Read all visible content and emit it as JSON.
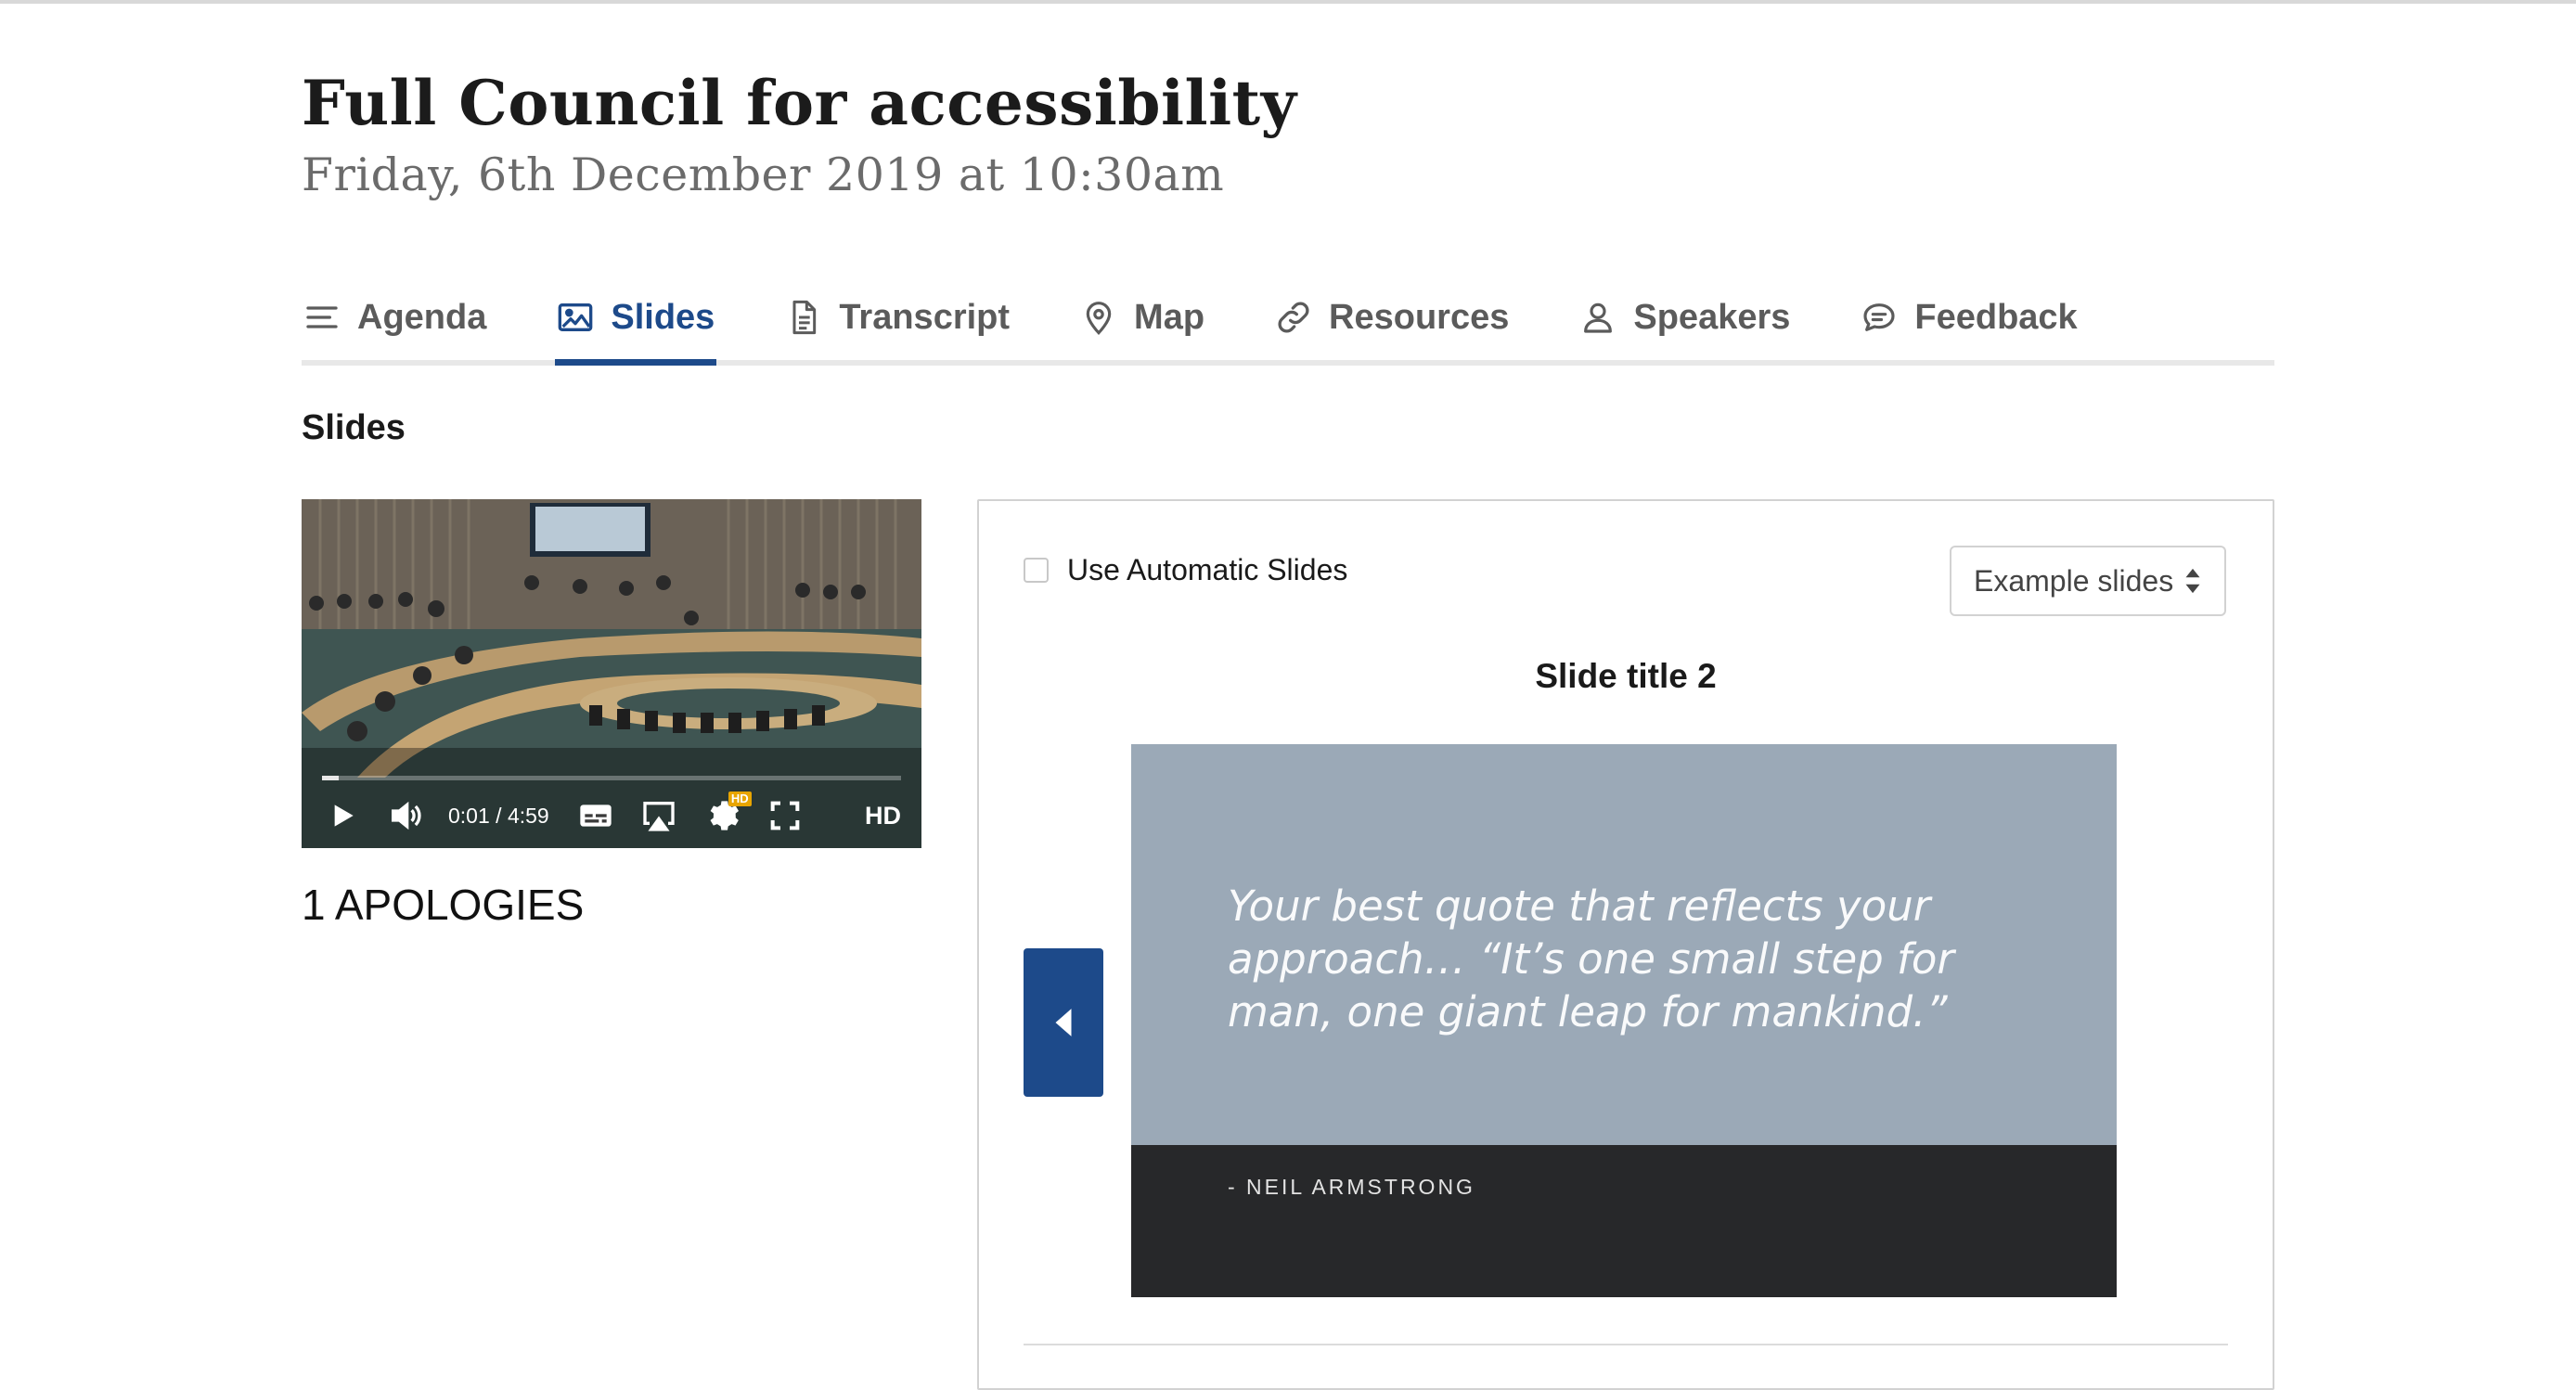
{
  "meeting": {
    "title": "Full Council for accessibility",
    "datetime": "Friday, 6th December 2019 at 10:30am"
  },
  "tabs": [
    {
      "label": "Agenda",
      "icon": "menu-lines-icon",
      "active": false
    },
    {
      "label": "Slides",
      "icon": "image-icon",
      "active": true
    },
    {
      "label": "Transcript",
      "icon": "document-icon",
      "active": false
    },
    {
      "label": "Map",
      "icon": "map-pin-icon",
      "active": false
    },
    {
      "label": "Resources",
      "icon": "link-icon",
      "active": false
    },
    {
      "label": "Speakers",
      "icon": "person-icon",
      "active": false
    },
    {
      "label": "Feedback",
      "icon": "speech-bubble-icon",
      "active": false
    }
  ],
  "section": {
    "heading": "Slides"
  },
  "video": {
    "current_time": "0:01",
    "separator": "/",
    "duration": "4:59",
    "progress_fraction": 0.003,
    "hd_badge": "HD",
    "hd_label": "HD"
  },
  "agenda_item": "1 APOLOGIES",
  "slides_panel": {
    "auto_slides_label": "Use Automatic Slides",
    "auto_slides_checked": false,
    "slide_set_selected": "Example slides",
    "slide_title": "Slide title 2",
    "slide": {
      "quote": "Your best quote that reflects your approach… “It’s one small step for man, one giant leap for mankind.”",
      "attribution": "- NEIL ARMSTRONG"
    }
  },
  "colors": {
    "accent": "#1d4a8a",
    "slide_background": "#9ba9b7",
    "slide_footer": "#27282a",
    "subtitle_grey": "#6b6b6b"
  }
}
